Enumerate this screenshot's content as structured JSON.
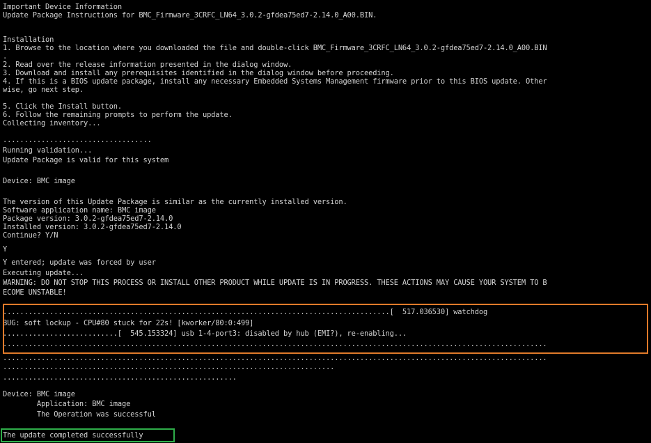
{
  "terminal": {
    "lines": [
      "Important Device Information",
      "Update Package Instructions for BMC_Firmware_3CRFC_LN64_3.0.2-gfdea75ed7-2.14.0_A00.BIN.",
      "",
      "Installation",
      "1. Browse to the location where you downloaded the file and double-click BMC_Firmware_3CRFC_LN64_3.0.2-gfdea75ed7-2.14.0_A00.BIN",
      ".",
      "2. Read over the release information presented in the dialog window.",
      "3. Download and install any prerequisites identified in the dialog window before proceeding.",
      "4. If this is a BIOS update package, install any necessary Embedded Systems Management firmware prior to this BIOS update. Other",
      "wise, go next step.",
      "5. Click the Install button.",
      "6. Follow the remaining prompts to perform the update.",
      "Collecting inventory...",
      "...................................",
      "Running validation...",
      "Update Package is valid for this system",
      "",
      "Device: BMC image",
      "",
      "The version of this Update Package is similar as the currently installed version.",
      "Software application name: BMC image",
      "Package version: 3.0.2-gfdea75ed7-2.14.0",
      "Installed version: 3.0.2-gfdea75ed7-2.14.0",
      "Continue? Y/N",
      "Y",
      "Y entered; update was forced by user",
      "Executing update...",
      "WARNING: DO NOT STOP THIS PROCESS OR INSTALL OTHER PRODUCT WHILE UPDATE IS IN PROGRESS. THESE ACTIONS MAY CAUSE YOUR SYSTEM TO B",
      "ECOME UNSTABLE!",
      "",
      "...........................................................................................[  517.036530] watchdog",
      "BUG: soft lockup - CPU#80 stuck for 22s! [kworker/80:0:499]",
      "...........................[  545.153324] usb 1-4-port3: disabled by hub (EMI?), re-enabling...",
      "................................................................................................................................",
      "",
      "................................................................................................................................",
      "..............................................................................",
      "",
      ".......................................................",
      "",
      "Device: BMC image",
      "        Application: BMC image",
      "        The Operation was successful",
      "",
      "The update completed successfully"
    ]
  },
  "colors": {
    "background": "#000000",
    "text": "#d2d2d2",
    "highlight_orange": "#e07a2a",
    "highlight_green": "#2fae4a"
  }
}
